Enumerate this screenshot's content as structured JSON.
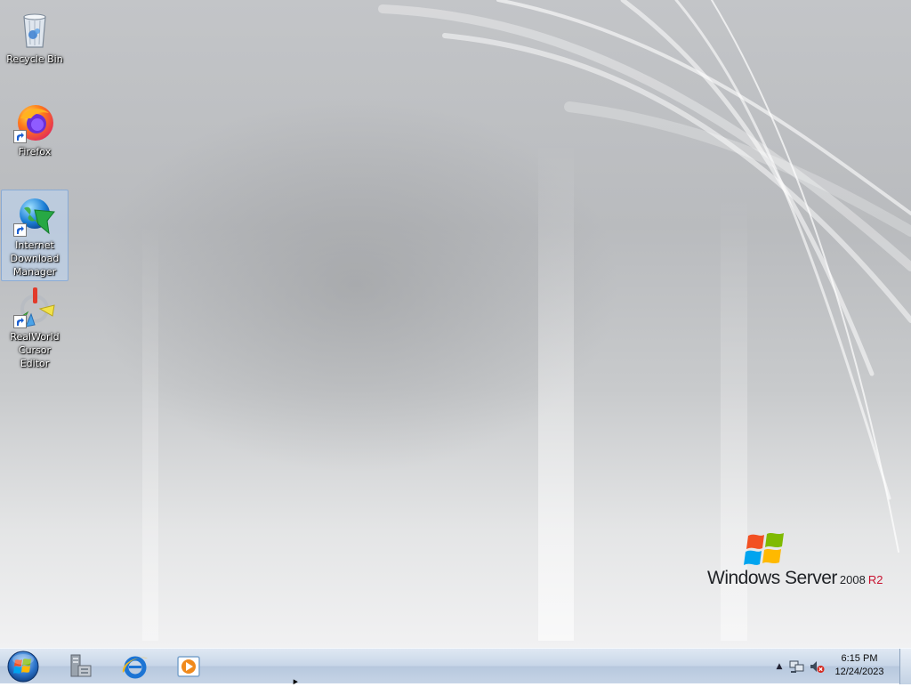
{
  "desktop": {
    "icons": [
      {
        "label": "Recycle Bin",
        "icon": "recycle-bin-icon",
        "shortcut": false,
        "selected": false
      },
      {
        "label": "Firefox",
        "icon": "firefox-icon",
        "shortcut": true,
        "selected": false
      },
      {
        "label": "Internet Download Manager",
        "icon": "idm-globe-icon",
        "shortcut": true,
        "selected": true
      },
      {
        "label": "RealWorld Cursor Editor",
        "icon": "cursor-editor-icon",
        "shortcut": true,
        "selected": false
      }
    ]
  },
  "branding": {
    "word1": "Windows Server",
    "word2": "2008",
    "word3": "R2",
    "accent_color": "#c8102e"
  },
  "taskbar": {
    "start_icon": "windows-orb-icon",
    "pinned": [
      {
        "icon": "server-manager-icon"
      },
      {
        "icon": "internet-explorer-icon"
      },
      {
        "icon": "media-player-icon"
      }
    ],
    "tray": {
      "chevron": "▲",
      "network_icon": "network-icon",
      "volume_icon": "volume-muted-icon",
      "time": "6:15 PM",
      "date": "12/24/2023"
    }
  }
}
